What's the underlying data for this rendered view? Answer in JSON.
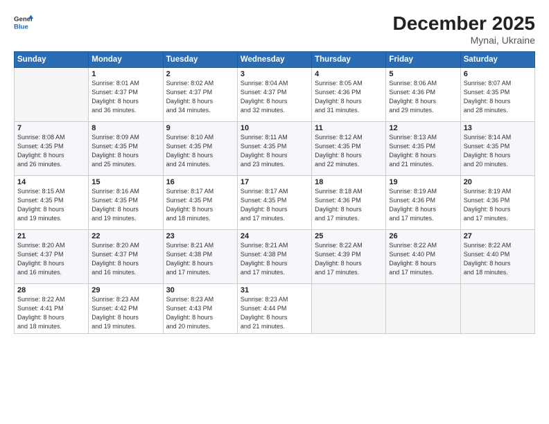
{
  "header": {
    "logo_general": "General",
    "logo_blue": "Blue",
    "month_year": "December 2025",
    "location": "Mynai, Ukraine"
  },
  "days_of_week": [
    "Sunday",
    "Monday",
    "Tuesday",
    "Wednesday",
    "Thursday",
    "Friday",
    "Saturday"
  ],
  "weeks": [
    [
      {
        "day": "",
        "sunrise": "",
        "sunset": "",
        "daylight": ""
      },
      {
        "day": "1",
        "sunrise": "Sunrise: 8:01 AM",
        "sunset": "Sunset: 4:37 PM",
        "daylight": "Daylight: 8 hours and 36 minutes."
      },
      {
        "day": "2",
        "sunrise": "Sunrise: 8:02 AM",
        "sunset": "Sunset: 4:37 PM",
        "daylight": "Daylight: 8 hours and 34 minutes."
      },
      {
        "day": "3",
        "sunrise": "Sunrise: 8:04 AM",
        "sunset": "Sunset: 4:37 PM",
        "daylight": "Daylight: 8 hours and 32 minutes."
      },
      {
        "day": "4",
        "sunrise": "Sunrise: 8:05 AM",
        "sunset": "Sunset: 4:36 PM",
        "daylight": "Daylight: 8 hours and 31 minutes."
      },
      {
        "day": "5",
        "sunrise": "Sunrise: 8:06 AM",
        "sunset": "Sunset: 4:36 PM",
        "daylight": "Daylight: 8 hours and 29 minutes."
      },
      {
        "day": "6",
        "sunrise": "Sunrise: 8:07 AM",
        "sunset": "Sunset: 4:35 PM",
        "daylight": "Daylight: 8 hours and 28 minutes."
      }
    ],
    [
      {
        "day": "7",
        "sunrise": "Sunrise: 8:08 AM",
        "sunset": "Sunset: 4:35 PM",
        "daylight": "Daylight: 8 hours and 26 minutes."
      },
      {
        "day": "8",
        "sunrise": "Sunrise: 8:09 AM",
        "sunset": "Sunset: 4:35 PM",
        "daylight": "Daylight: 8 hours and 25 minutes."
      },
      {
        "day": "9",
        "sunrise": "Sunrise: 8:10 AM",
        "sunset": "Sunset: 4:35 PM",
        "daylight": "Daylight: 8 hours and 24 minutes."
      },
      {
        "day": "10",
        "sunrise": "Sunrise: 8:11 AM",
        "sunset": "Sunset: 4:35 PM",
        "daylight": "Daylight: 8 hours and 23 minutes."
      },
      {
        "day": "11",
        "sunrise": "Sunrise: 8:12 AM",
        "sunset": "Sunset: 4:35 PM",
        "daylight": "Daylight: 8 hours and 22 minutes."
      },
      {
        "day": "12",
        "sunrise": "Sunrise: 8:13 AM",
        "sunset": "Sunset: 4:35 PM",
        "daylight": "Daylight: 8 hours and 21 minutes."
      },
      {
        "day": "13",
        "sunrise": "Sunrise: 8:14 AM",
        "sunset": "Sunset: 4:35 PM",
        "daylight": "Daylight: 8 hours and 20 minutes."
      }
    ],
    [
      {
        "day": "14",
        "sunrise": "Sunrise: 8:15 AM",
        "sunset": "Sunset: 4:35 PM",
        "daylight": "Daylight: 8 hours and 19 minutes."
      },
      {
        "day": "15",
        "sunrise": "Sunrise: 8:16 AM",
        "sunset": "Sunset: 4:35 PM",
        "daylight": "Daylight: 8 hours and 19 minutes."
      },
      {
        "day": "16",
        "sunrise": "Sunrise: 8:17 AM",
        "sunset": "Sunset: 4:35 PM",
        "daylight": "Daylight: 8 hours and 18 minutes."
      },
      {
        "day": "17",
        "sunrise": "Sunrise: 8:17 AM",
        "sunset": "Sunset: 4:35 PM",
        "daylight": "Daylight: 8 hours and 17 minutes."
      },
      {
        "day": "18",
        "sunrise": "Sunrise: 8:18 AM",
        "sunset": "Sunset: 4:36 PM",
        "daylight": "Daylight: 8 hours and 17 minutes."
      },
      {
        "day": "19",
        "sunrise": "Sunrise: 8:19 AM",
        "sunset": "Sunset: 4:36 PM",
        "daylight": "Daylight: 8 hours and 17 minutes."
      },
      {
        "day": "20",
        "sunrise": "Sunrise: 8:19 AM",
        "sunset": "Sunset: 4:36 PM",
        "daylight": "Daylight: 8 hours and 17 minutes."
      }
    ],
    [
      {
        "day": "21",
        "sunrise": "Sunrise: 8:20 AM",
        "sunset": "Sunset: 4:37 PM",
        "daylight": "Daylight: 8 hours and 16 minutes."
      },
      {
        "day": "22",
        "sunrise": "Sunrise: 8:20 AM",
        "sunset": "Sunset: 4:37 PM",
        "daylight": "Daylight: 8 hours and 16 minutes."
      },
      {
        "day": "23",
        "sunrise": "Sunrise: 8:21 AM",
        "sunset": "Sunset: 4:38 PM",
        "daylight": "Daylight: 8 hours and 17 minutes."
      },
      {
        "day": "24",
        "sunrise": "Sunrise: 8:21 AM",
        "sunset": "Sunset: 4:38 PM",
        "daylight": "Daylight: 8 hours and 17 minutes."
      },
      {
        "day": "25",
        "sunrise": "Sunrise: 8:22 AM",
        "sunset": "Sunset: 4:39 PM",
        "daylight": "Daylight: 8 hours and 17 minutes."
      },
      {
        "day": "26",
        "sunrise": "Sunrise: 8:22 AM",
        "sunset": "Sunset: 4:40 PM",
        "daylight": "Daylight: 8 hours and 17 minutes."
      },
      {
        "day": "27",
        "sunrise": "Sunrise: 8:22 AM",
        "sunset": "Sunset: 4:40 PM",
        "daylight": "Daylight: 8 hours and 18 minutes."
      }
    ],
    [
      {
        "day": "28",
        "sunrise": "Sunrise: 8:22 AM",
        "sunset": "Sunset: 4:41 PM",
        "daylight": "Daylight: 8 hours and 18 minutes."
      },
      {
        "day": "29",
        "sunrise": "Sunrise: 8:23 AM",
        "sunset": "Sunset: 4:42 PM",
        "daylight": "Daylight: 8 hours and 19 minutes."
      },
      {
        "day": "30",
        "sunrise": "Sunrise: 8:23 AM",
        "sunset": "Sunset: 4:43 PM",
        "daylight": "Daylight: 8 hours and 20 minutes."
      },
      {
        "day": "31",
        "sunrise": "Sunrise: 8:23 AM",
        "sunset": "Sunset: 4:44 PM",
        "daylight": "Daylight: 8 hours and 21 minutes."
      },
      {
        "day": "",
        "sunrise": "",
        "sunset": "",
        "daylight": ""
      },
      {
        "day": "",
        "sunrise": "",
        "sunset": "",
        "daylight": ""
      },
      {
        "day": "",
        "sunrise": "",
        "sunset": "",
        "daylight": ""
      }
    ]
  ]
}
